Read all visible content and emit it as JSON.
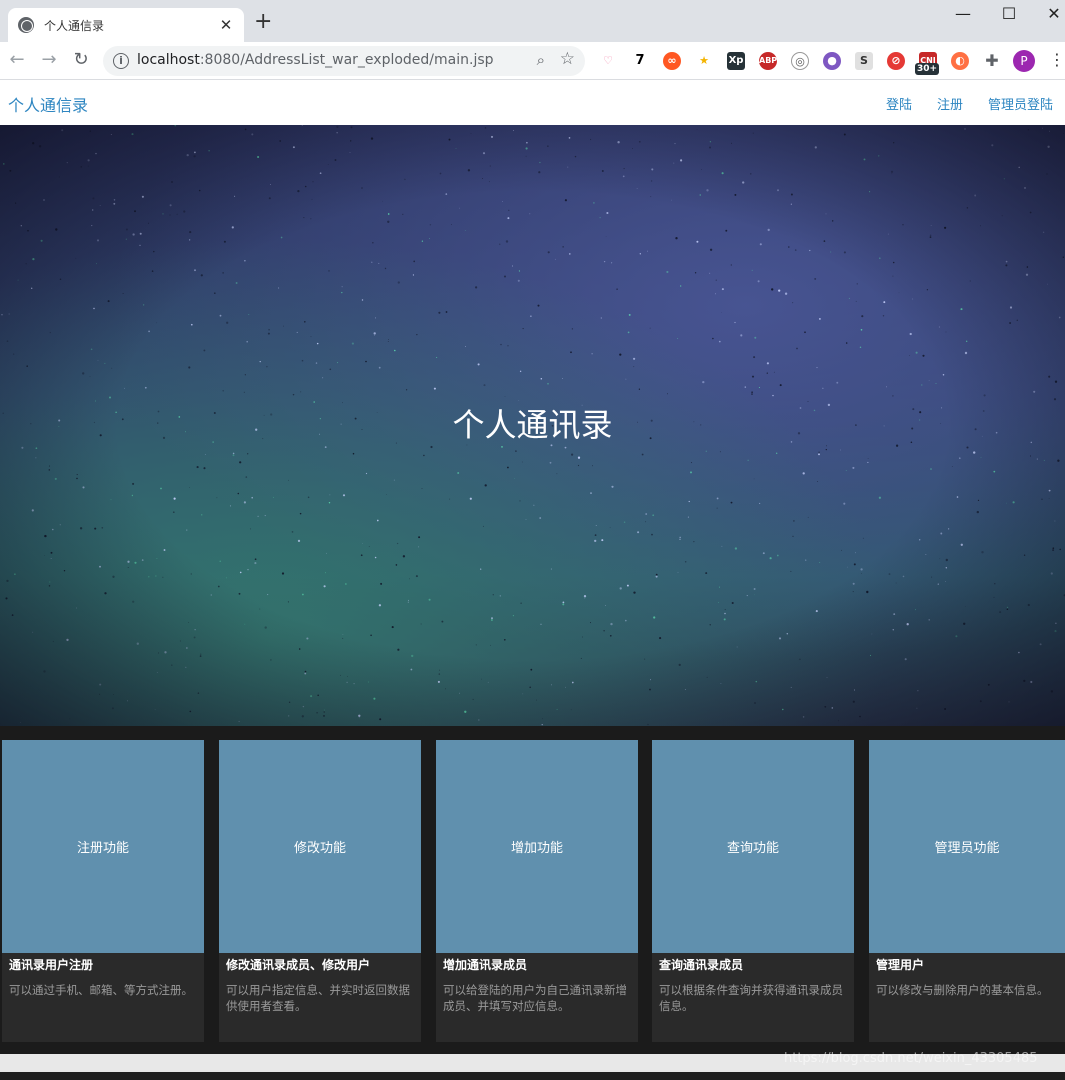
{
  "browser": {
    "tab_title": "个人通信录",
    "new_tab": "+",
    "tab_close": "✕",
    "url_host": "localhost",
    "url_rest": ":8080/AddressList_war_exploded/main.jsp",
    "ext_badge": "30+",
    "ext_seven": "7",
    "profile_initial": "P"
  },
  "site": {
    "brand": "个人通信录",
    "nav": {
      "login": "登陆",
      "register": "注册",
      "admin_login": "管理员登陆"
    }
  },
  "hero": {
    "title": "个人通讯录"
  },
  "cards": [
    {
      "thumb": "注册功能",
      "title": "通讯录用户注册",
      "desc": "可以通过手机、邮箱、等方式注册。"
    },
    {
      "thumb": "修改功能",
      "title": "修改通讯录成员、修改用户",
      "desc": "可以用户指定信息、并实时返回数据供使用者查看。"
    },
    {
      "thumb": "增加功能",
      "title": "增加通讯录成员",
      "desc": "可以给登陆的用户为自己通讯录新增成员、并填写对应信息。"
    },
    {
      "thumb": "查询功能",
      "title": "查询通讯录成员",
      "desc": "可以根据条件查询并获得通讯录成员信息。"
    },
    {
      "thumb": "管理员功能",
      "title": "管理用户",
      "desc": "可以修改与删除用户的基本信息。"
    }
  ],
  "watermark": "https://blog.csdn.net/weixin_43305485",
  "colors": {
    "link": "#2e86c1",
    "card_thumb": "#6090ae",
    "card_body": "#2a2a2a",
    "page_bg": "#1b1b1b"
  }
}
